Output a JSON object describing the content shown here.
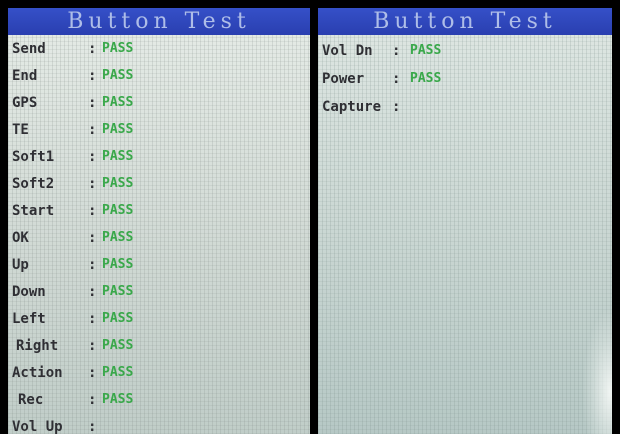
{
  "left_screen": {
    "title": "Button Test",
    "rows": [
      {
        "label": "Send",
        "colon": ":",
        "value": "PASS"
      },
      {
        "label": "End",
        "colon": ":",
        "value": "PASS"
      },
      {
        "label": "GPS",
        "colon": ":",
        "value": "PASS"
      },
      {
        "label": "TE",
        "colon": ":",
        "value": "PASS"
      },
      {
        "label": "Soft1",
        "colon": ":",
        "value": "PASS"
      },
      {
        "label": "Soft2",
        "colon": ":",
        "value": "PASS"
      },
      {
        "label": "Start",
        "colon": ":",
        "value": "PASS"
      },
      {
        "label": "OK",
        "colon": ":",
        "value": "PASS"
      },
      {
        "label": "Up",
        "colon": ":",
        "value": "PASS"
      },
      {
        "label": "Down",
        "colon": ":",
        "value": "PASS"
      },
      {
        "label": "Left",
        "colon": ":",
        "value": "PASS"
      },
      {
        "label": "Right",
        "colon": ":",
        "value": "PASS"
      },
      {
        "label": "Action",
        "colon": ":",
        "value": "PASS"
      },
      {
        "label": "Rec",
        "colon": ":",
        "value": "PASS"
      },
      {
        "label": "Vol Up",
        "colon": ":",
        "value": ""
      }
    ]
  },
  "right_screen": {
    "title": "Button Test",
    "rows": [
      {
        "label": "Vol Dn",
        "colon": ":",
        "value": "PASS"
      },
      {
        "label": "Power",
        "colon": ":",
        "value": "PASS"
      },
      {
        "label": "Capture",
        "colon": ":",
        "value": ""
      }
    ]
  },
  "colors": {
    "title_bar": "#2a3fb0",
    "title_text": "#aebde8",
    "label_text": "#2f2f34",
    "pass_text": "#39a84a"
  }
}
